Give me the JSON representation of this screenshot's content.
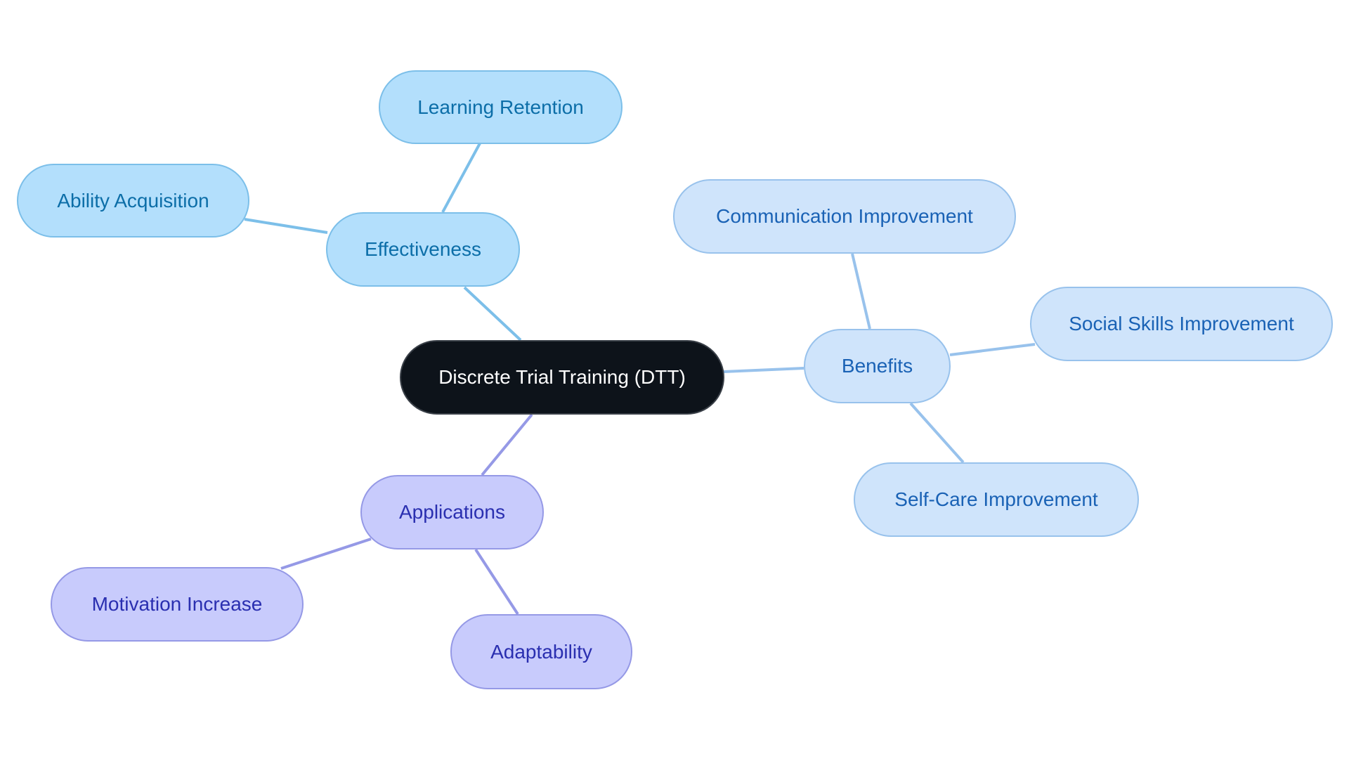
{
  "root": {
    "label": "Discrete Trial Training (DTT)"
  },
  "branches": [
    {
      "label": "Effectiveness",
      "color": "#7cbfe9",
      "children": [
        {
          "label": "Learning Retention"
        },
        {
          "label": "Ability Acquisition"
        }
      ]
    },
    {
      "label": "Benefits",
      "color": "#98c2ec",
      "children": [
        {
          "label": "Communication Improvement"
        },
        {
          "label": "Social Skills Improvement"
        },
        {
          "label": "Self-Care Improvement"
        }
      ]
    },
    {
      "label": "Applications",
      "color": "#9599e6",
      "children": [
        {
          "label": "Motivation Increase"
        },
        {
          "label": "Adaptability"
        }
      ]
    }
  ]
}
